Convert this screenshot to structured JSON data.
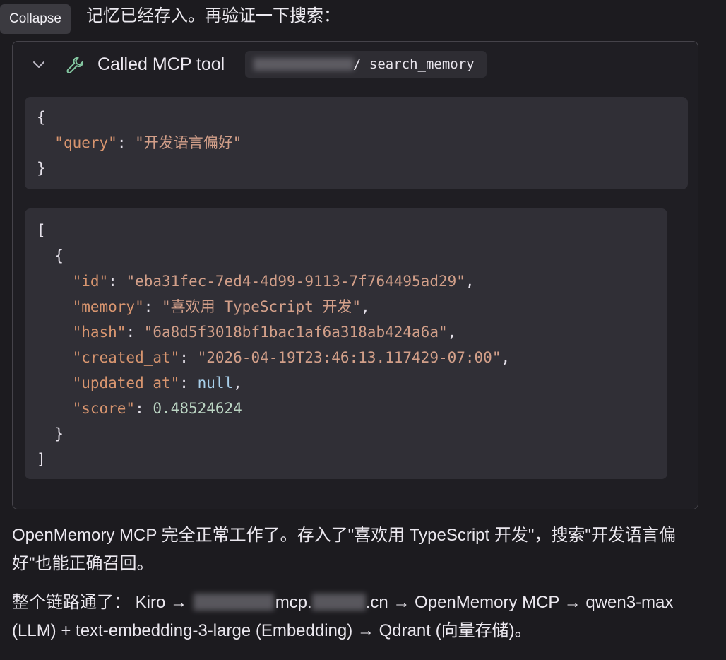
{
  "tooltip": {
    "label": "Collapse"
  },
  "intro": {
    "text": "记忆已经存入。再验证一下搜索："
  },
  "tool_call": {
    "title": "Called MCP tool",
    "tool_name": "/ search_memory",
    "input": {
      "open_brace": "{",
      "key": "\"query\"",
      "colon": ": ",
      "value": "\"开发语言偏好\"",
      "close_brace": "}"
    },
    "output": {
      "open_bracket": "[",
      "open_brace": "{",
      "fields": [
        {
          "key": "\"id\"",
          "value": "\"eba31fec-7ed4-4d99-9113-7f764495ad29\"",
          "suffix": ","
        },
        {
          "key": "\"memory\"",
          "value": "\"喜欢用 TypeScript 开发\"",
          "suffix": ","
        },
        {
          "key": "\"hash\"",
          "value": "\"6a8d5f3018bf1bac1af6a318ab424a6a\"",
          "suffix": ","
        },
        {
          "key": "\"created_at\"",
          "value": "\"2026-04-19T23:46:13.117429-07:00\"",
          "suffix": ","
        },
        {
          "key": "\"updated_at\"",
          "value": "null",
          "suffix": ","
        },
        {
          "key": "\"score\"",
          "value": "0.48524624",
          "suffix": ""
        }
      ],
      "close_brace": "}",
      "close_bracket": "]"
    }
  },
  "summary": {
    "text": "OpenMemory MCP 完全正常工作了。存入了\"喜欢用 TypeScript 开发\"，搜索\"开发语言偏好\"也能正确召回。"
  },
  "chain": {
    "prefix": "整个链路通了： Kiro → ",
    "mcp_part": "mcp.",
    "domain_suffix": ".cn",
    "rest": " → OpenMemory MCP → qwen3-max (LLM) + text-embedding-3-large (Embedding) → Qdrant (向量存储)。"
  },
  "colors": {
    "background": "#1c1b1f",
    "card_border": "#45434a",
    "code_background": "#302f36",
    "json_key": "#d8956f",
    "json_string": "#d29f89",
    "json_number": "#bcd6c4",
    "json_null": "#a8cfea",
    "icon_green": "#84c7a1"
  },
  "icons": {
    "chevron": "chevron-down-icon",
    "tool": "wrench-icon"
  }
}
